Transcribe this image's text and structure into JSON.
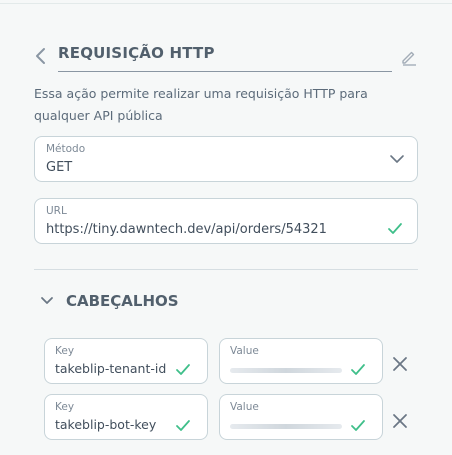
{
  "header": {
    "title": "REQUISIÇÃO HTTP"
  },
  "description": "Essa ação permite realizar uma requisição HTTP para qualquer API pública",
  "method_field": {
    "label": "Método",
    "value": "GET"
  },
  "url_field": {
    "label": "URL",
    "value": "https://tiny.dawntech.dev/api/orders/54321"
  },
  "headers_section": {
    "title": "CABEÇALHOS",
    "rows": [
      {
        "key_label": "Key",
        "key_value": "takeblip-tenant-id",
        "value_label": "Value"
      },
      {
        "key_label": "Key",
        "key_value": "takeblip-bot-key",
        "value_label": "Value"
      }
    ]
  },
  "icons": {
    "back": "chevron-left-icon",
    "edit": "pencil-icon",
    "dropdown": "chevron-down-icon",
    "valid": "check-icon",
    "section_toggle": "chevron-down-icon",
    "remove": "close-icon"
  },
  "colors": {
    "background": "#f6f8f8",
    "text": "#505f79",
    "check": "#3fbf8a",
    "border": "#c8d4d9"
  }
}
